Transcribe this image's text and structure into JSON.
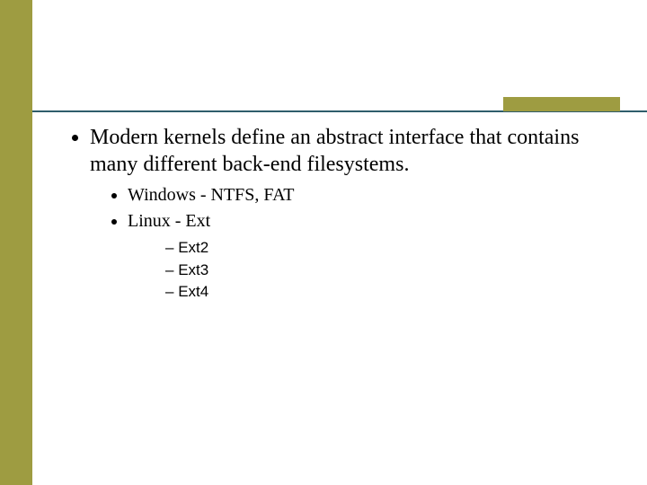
{
  "bullets": {
    "main": "Modern kernels define an abstract interface that contains many different  back-end filesystems.",
    "sub": [
      "Windows - NTFS, FAT",
      "Linux - Ext"
    ],
    "subsub": [
      "Ext2",
      "Ext3",
      "Ext4"
    ]
  }
}
